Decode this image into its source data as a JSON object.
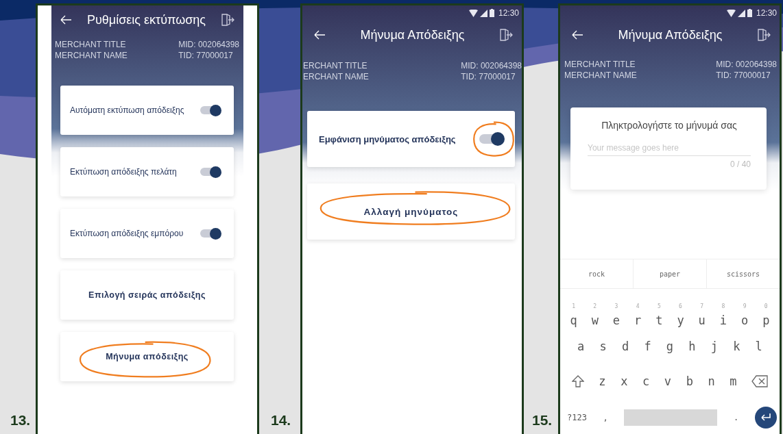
{
  "screens": [
    {
      "number": "13.",
      "kind": "settings",
      "title": "Ρυθμίσεις εκτύπωσης",
      "merchant": {
        "title": "MERCHANT TITLE",
        "name": "MERCHANT NAME",
        "mid": "MID: 002064398",
        "tid": "TID: 77000017"
      },
      "items": [
        {
          "kind": "toggle",
          "label": "Αυτόματη εκτύπωση απόδειξης",
          "on": true,
          "highlighted": false
        },
        {
          "kind": "toggle",
          "label": "Εκτύπωση απόδειξης πελάτη",
          "on": true,
          "highlighted": false
        },
        {
          "kind": "toggle",
          "label": "Εκτύπωση απόδειξης εμπόρου",
          "on": true,
          "highlighted": false
        },
        {
          "kind": "button",
          "label": "Επιλογή σειράς απόδειξης",
          "highlighted": false
        },
        {
          "kind": "button",
          "label": "Μήνυμα απόδειξης",
          "highlighted": true
        }
      ]
    },
    {
      "number": "14.",
      "kind": "settings",
      "status_time": "12:30",
      "title": "Μήνυμα Απόδειξης",
      "merchant": {
        "title": "ERCHANT TITLE",
        "name": "ERCHANT NAME",
        "mid": "MID: 002064398",
        "tid": "TID: 77000017"
      },
      "items": [
        {
          "kind": "toggle",
          "label": "Εμφάνιση μηνύματος απόδειξης",
          "on": true,
          "highlighted": true
        },
        {
          "kind": "button",
          "label": "Αλλαγή μηνύματος",
          "highlighted": true
        }
      ]
    },
    {
      "number": "15.",
      "kind": "input",
      "status_time": "12:30",
      "title": "Μήνυμα Απόδειξης",
      "merchant": {
        "title": "MERCHANT TITLE",
        "name": "MERCHANT NAME",
        "mid": "MID: 002064398",
        "tid": "TID: 77000017"
      },
      "dialog": {
        "title": "Πληκτρολογήστε το μήνυμά σας",
        "placeholder": "Your message goes here",
        "counter": "0 / 40"
      },
      "keyboard": {
        "suggestions": [
          "rock",
          "paper",
          "scissors"
        ],
        "rows": [
          [
            {
              "kind": "char",
              "label": "q",
              "hint": "1"
            },
            {
              "kind": "char",
              "label": "w",
              "hint": "2"
            },
            {
              "kind": "char",
              "label": "e",
              "hint": "3"
            },
            {
              "kind": "char",
              "label": "r",
              "hint": "4"
            },
            {
              "kind": "char",
              "label": "t",
              "hint": "5"
            },
            {
              "kind": "char",
              "label": "y",
              "hint": "6"
            },
            {
              "kind": "char",
              "label": "u",
              "hint": "7"
            },
            {
              "kind": "char",
              "label": "i",
              "hint": "8"
            },
            {
              "kind": "char",
              "label": "o",
              "hint": "9"
            },
            {
              "kind": "char",
              "label": "p",
              "hint": "0"
            }
          ],
          [
            {
              "kind": "char",
              "label": "a"
            },
            {
              "kind": "char",
              "label": "s"
            },
            {
              "kind": "char",
              "label": "d"
            },
            {
              "kind": "char",
              "label": "f"
            },
            {
              "kind": "char",
              "label": "g"
            },
            {
              "kind": "char",
              "label": "h"
            },
            {
              "kind": "char",
              "label": "j"
            },
            {
              "kind": "char",
              "label": "k"
            },
            {
              "kind": "char",
              "label": "l"
            }
          ],
          [
            {
              "kind": "shift"
            },
            {
              "kind": "char",
              "label": "z"
            },
            {
              "kind": "char",
              "label": "x"
            },
            {
              "kind": "char",
              "label": "c"
            },
            {
              "kind": "char",
              "label": "v"
            },
            {
              "kind": "char",
              "label": "b"
            },
            {
              "kind": "char",
              "label": "n"
            },
            {
              "kind": "char",
              "label": "m"
            },
            {
              "kind": "backspace"
            }
          ],
          [
            {
              "kind": "char",
              "label": "?123"
            },
            {
              "kind": "char",
              "label": ","
            },
            {
              "kind": "space"
            },
            {
              "kind": "char",
              "label": "."
            },
            {
              "kind": "enter"
            }
          ]
        ]
      }
    }
  ]
}
